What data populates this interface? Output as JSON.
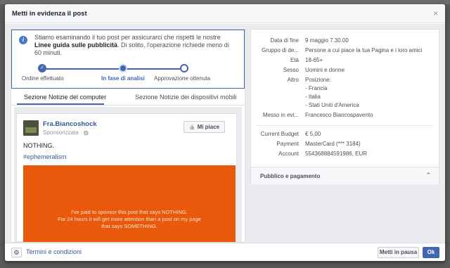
{
  "dialog": {
    "title": "Metti in evidenza il post",
    "close_glyph": "×"
  },
  "review": {
    "message_before": "Stiamo esaminando il tuo post per assicurarci che rispetti le nostre ",
    "message_link": "Linee guida sulle pubblicità",
    "message_after": ". Di solito, l'operazione richiede meno di 60 minuti.",
    "steps": [
      "Ordine effettuato",
      "In fase di analisi",
      "Approvazione ottenuta"
    ],
    "check_glyph": "✓"
  },
  "tabs": [
    "Sezione Notizie del computer",
    "Sezione Notizie dei dispositivi mobili"
  ],
  "post": {
    "page_name": "Fra.Biancoshock",
    "sponsored_label": "Sponsorizzata",
    "globe_glyph": "🌐",
    "like_label": "Mi piace",
    "like_glyph": "👍",
    "text": "NOTHING.",
    "hashtag": "#ephemeralism",
    "image_lines": [
      "I've paid to sponsor this post that says NOTHING.",
      "For 24 hours it will get more attention than a post on my page",
      "that says SOMETHING."
    ],
    "image_color": "#e8590c"
  },
  "details": {
    "rows": [
      {
        "label": "Data di fine",
        "value": "9 maggio 7.30.00"
      },
      {
        "label": "Gruppo di de...",
        "value": "Persone a cui piace la tua Pagina e i loro amici"
      },
      {
        "label": "Età",
        "value": "18-65+"
      },
      {
        "label": "Sesso",
        "value": "Uomini e donne"
      },
      {
        "label": "Altro",
        "value": "Posizione:"
      },
      {
        "label": "",
        "value": "- Francia"
      },
      {
        "label": "",
        "value": "- Italia"
      },
      {
        "label": "",
        "value": "- Stati Uniti d'America"
      },
      {
        "label": "Messo in evi...",
        "value": "Francesco Biancospavento"
      }
    ],
    "budget_rows": [
      {
        "label": "Current Budget",
        "value": "€ 5,00"
      },
      {
        "label": "Payment",
        "value": "MasterCard (*** 3184)"
      },
      {
        "label": "Account",
        "value": "554368884591986, EUR"
      }
    ],
    "section_title": "Pubblico e pagamento",
    "chevron_glyph": "⌃"
  },
  "footer": {
    "gear_glyph": "⚙",
    "terms_label": "Termini e condizioni",
    "pause_label": "Metti in pausa",
    "ok_label": "Ok"
  },
  "colors": {
    "accent": "#4267b2",
    "link": "#365899"
  }
}
